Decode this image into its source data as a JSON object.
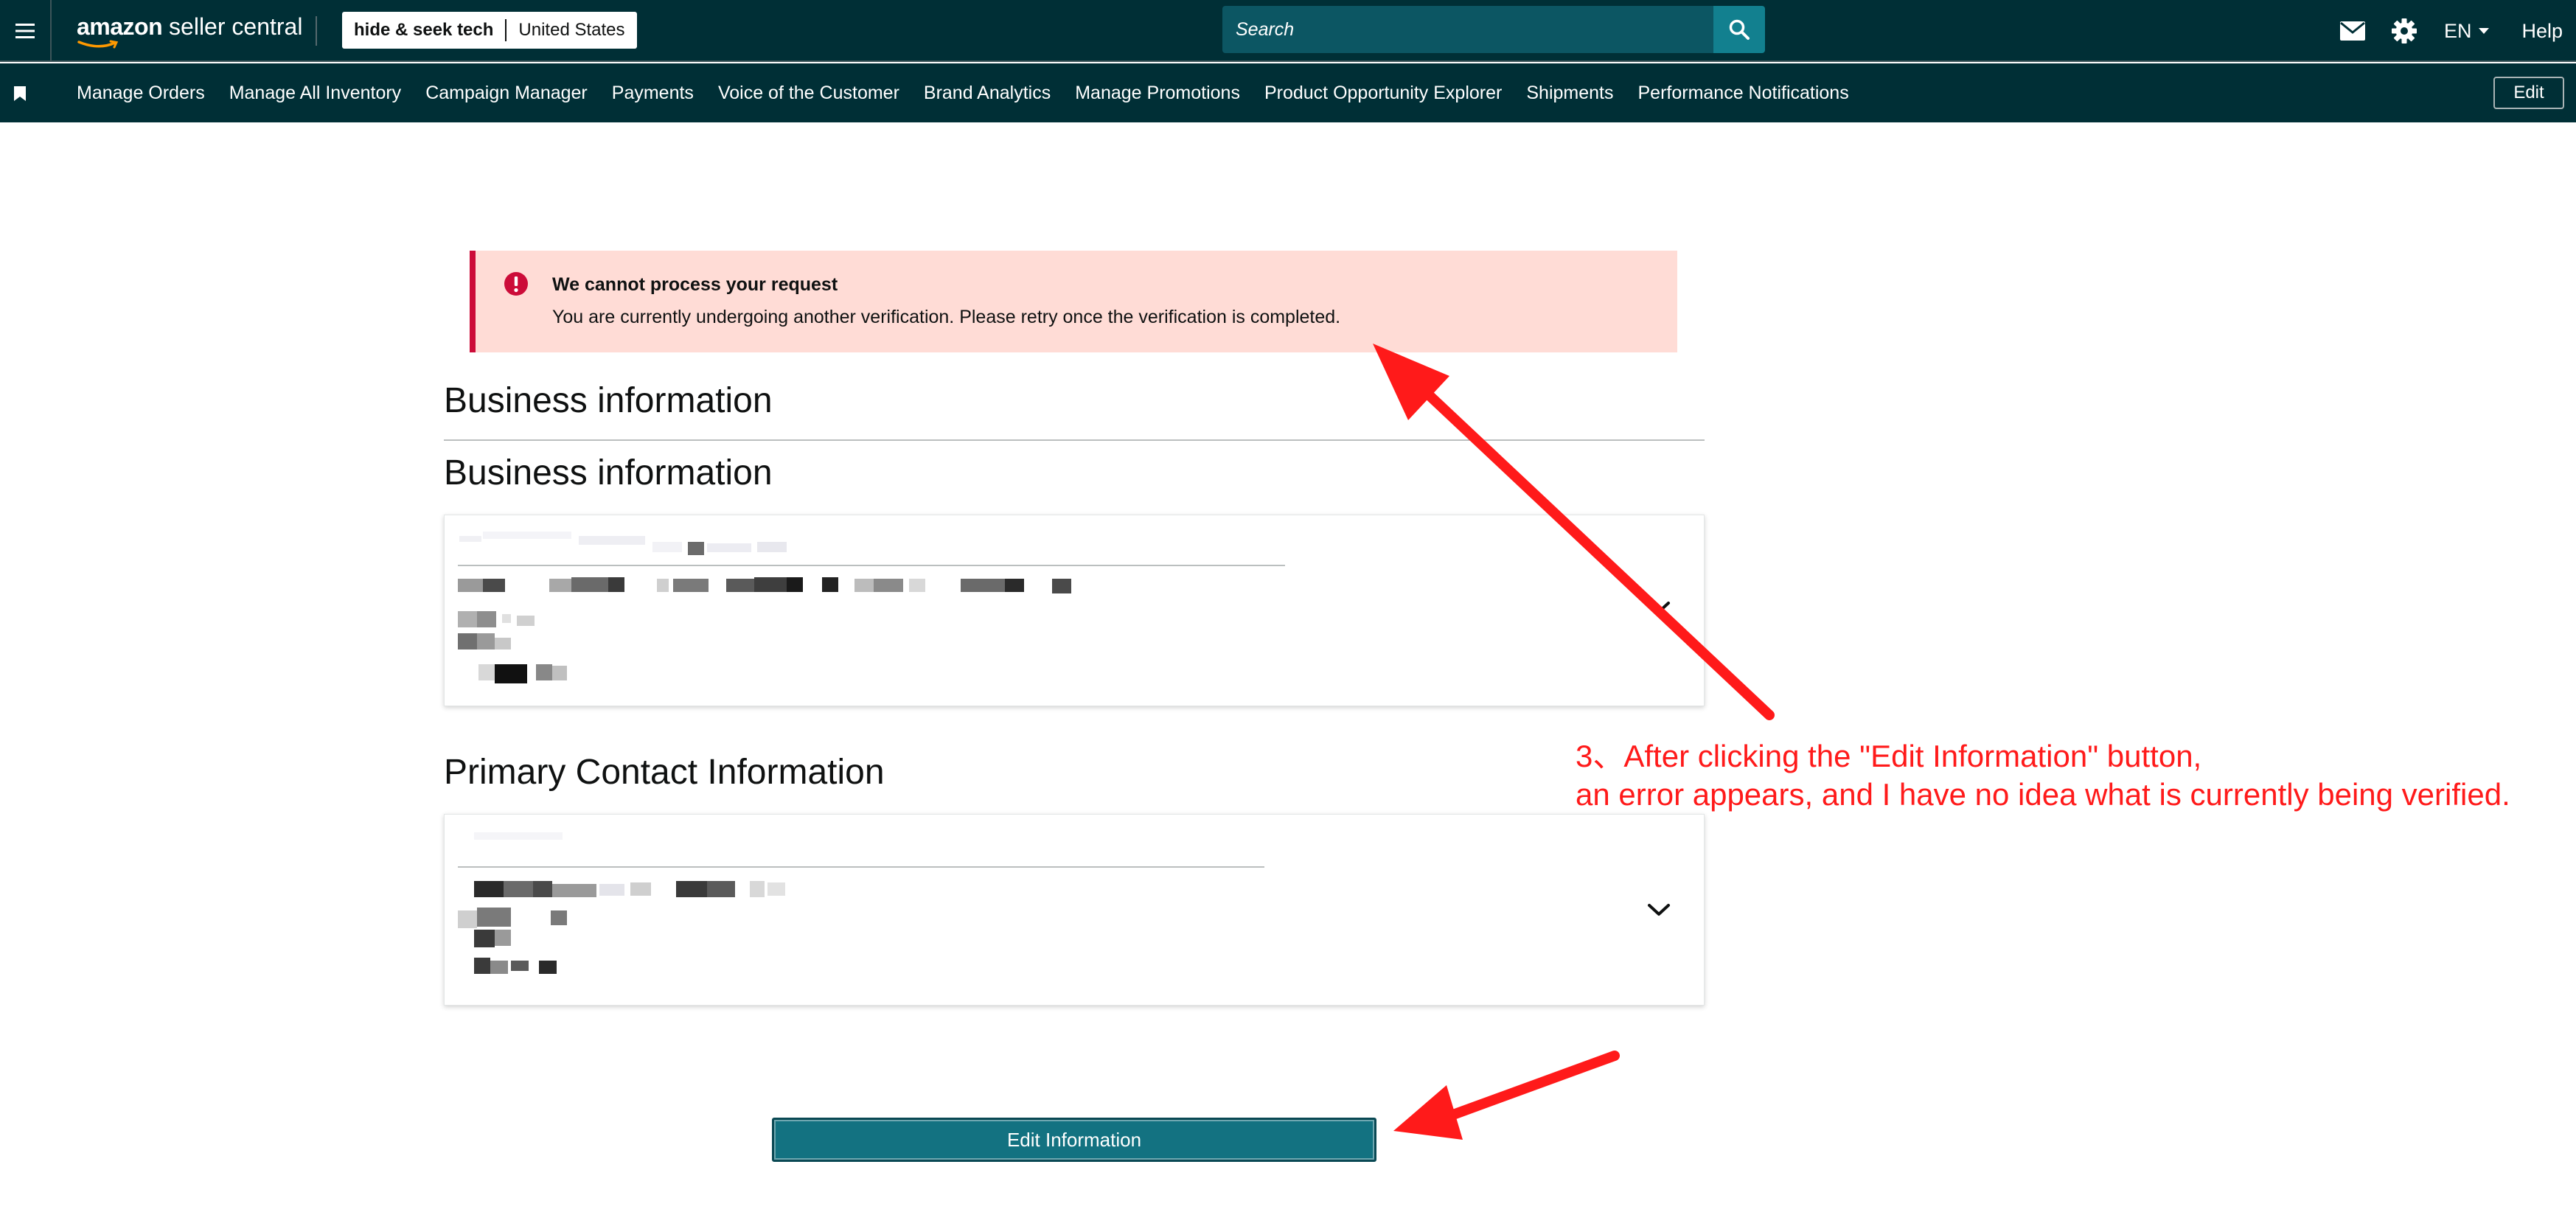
{
  "header": {
    "logo_brand": "amazon",
    "logo_rest": " seller central",
    "store_name": "hide & seek tech",
    "marketplace": "United States",
    "search_placeholder": "Search",
    "language": "EN",
    "help_label": "Help",
    "icons": [
      "menu-icon",
      "mail-icon",
      "gear-icon",
      "search-icon"
    ]
  },
  "nav": {
    "items": [
      "Manage Orders",
      "Manage All Inventory",
      "Campaign Manager",
      "Payments",
      "Voice of the Customer",
      "Brand Analytics",
      "Manage Promotions",
      "Product Opportunity Explorer",
      "Shipments",
      "Performance Notifications"
    ],
    "edit_label": "Edit"
  },
  "alert": {
    "title": "We cannot process your request",
    "message": "You are currently undergoing another verification. Please retry once the verification is completed."
  },
  "main": {
    "page_heading": "Business information",
    "business_heading": "Business information",
    "contact_heading": "Primary Contact Information",
    "edit_button_label": "Edit Information"
  },
  "annotation": {
    "line1": "3、After clicking the \"Edit Information\" button,",
    "line2": "an error appears, and I have no idea what is currently being verified.",
    "color": "#ff1a1a"
  },
  "colors": {
    "header_bg": "#002f36",
    "alert_bg": "#ffdcd6",
    "alert_accent": "#cc0c39",
    "primary_button": "#137281"
  }
}
